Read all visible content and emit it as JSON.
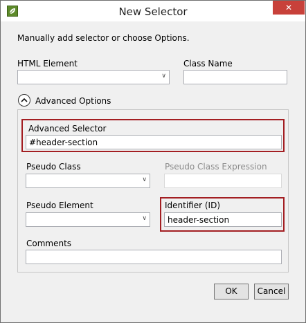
{
  "window": {
    "title": "New Selector",
    "close_symbol": "✕"
  },
  "intro": "Manually add selector or choose Options.",
  "html_element": {
    "label": "HTML Element",
    "value": ""
  },
  "class_name": {
    "label": "Class Name",
    "value": ""
  },
  "advanced_toggle": {
    "label": "Advanced Options"
  },
  "advanced_selector": {
    "label": "Advanced Selector",
    "value": "#header-section"
  },
  "pseudo_class": {
    "label": "Pseudo Class",
    "value": ""
  },
  "pseudo_class_expression": {
    "label": "Pseudo Class Expression",
    "value": ""
  },
  "pseudo_element": {
    "label": "Pseudo Element",
    "value": ""
  },
  "identifier": {
    "label": "Identifier (ID)",
    "value": "header-section"
  },
  "comments": {
    "label": "Comments",
    "value": ""
  },
  "buttons": {
    "ok": "OK",
    "cancel": "Cancel"
  },
  "colors": {
    "highlight": "#a31e22",
    "close": "#c8413a",
    "app_icon": "#5d8a2a"
  },
  "icons": {
    "app": "leaf-app-icon",
    "close": "close-icon",
    "toggle": "chevron-up-icon",
    "dropdown": "chevron-down-icon"
  }
}
